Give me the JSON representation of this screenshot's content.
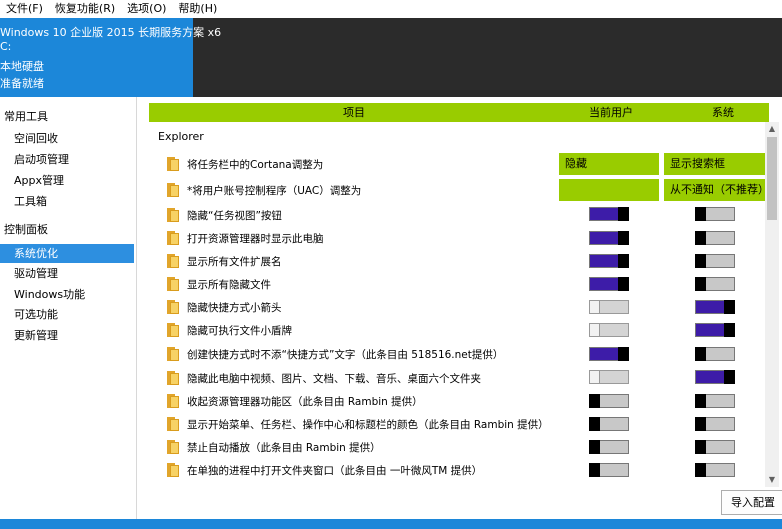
{
  "menu": [
    "文件(F)",
    "恢复功能(R)",
    "选项(O)",
    "帮助(H)"
  ],
  "header": {
    "os": "Windows 10 企业版 2015 长期服务方案 x6",
    "drive": "C:",
    "disk": "本地硬盘",
    "status": "准备就绪"
  },
  "sidebar": {
    "group1": "常用工具",
    "group1_items": [
      "空间回收",
      "启动项管理",
      "Appx管理",
      "工具箱"
    ],
    "group2": "控制面板",
    "group2_items": [
      "系统优化",
      "驱动管理",
      "Windows功能",
      "可选功能",
      "更新管理"
    ],
    "selected": "系统优化"
  },
  "columns": {
    "item": "项目",
    "user": "当前用户",
    "system": "系统"
  },
  "section": "Explorer",
  "rows": [
    {
      "label": "将任务栏中的Cortana调整为",
      "user": "隐藏",
      "system": "显示搜索框"
    },
    {
      "label": "*将用户账号控制程序（UAC）调整为",
      "user": "",
      "system": "从不通知（不推荐）"
    },
    {
      "label": "隐藏“任务视图”按钮",
      "user": "on",
      "system": "off"
    },
    {
      "label": "打开资源管理器时显示此电脑",
      "user": "on",
      "system": "off"
    },
    {
      "label": "显示所有文件扩展名",
      "user": "on",
      "system": "off"
    },
    {
      "label": "显示所有隐藏文件",
      "user": "on",
      "system": "off"
    },
    {
      "label": "隐藏快捷方式小箭头",
      "user": "off-light",
      "system": "on"
    },
    {
      "label": "隐藏可执行文件小盾牌",
      "user": "off-light",
      "system": "on"
    },
    {
      "label": "创建快捷方式时不添“快捷方式”文字（此条目由 518516.net提供）",
      "user": "on",
      "system": "off"
    },
    {
      "label": "隐藏此电脑中视频、图片、文档、下载、音乐、桌面六个文件夹",
      "user": "off-light",
      "system": "on"
    },
    {
      "label": "收起资源管理器功能区（此条目由 Rambin 提供）",
      "user": "off",
      "system": "off"
    },
    {
      "label": "显示开始菜单、任务栏、操作中心和标题栏的颜色（此条目由 Rambin 提供）",
      "user": "off",
      "system": "off"
    },
    {
      "label": "禁止自动播放（此条目由 Rambin 提供）",
      "user": "off",
      "system": "off"
    },
    {
      "label": "在单独的进程中打开文件夹窗口（此条目由 一叶微风TM 提供）",
      "user": "off",
      "system": "off"
    }
  ],
  "import_button": "导入配置",
  "colors": {
    "accent_green": "#99cc00",
    "accent_blue": "#1c87d9",
    "toggle_on": "#3d1ca8"
  }
}
